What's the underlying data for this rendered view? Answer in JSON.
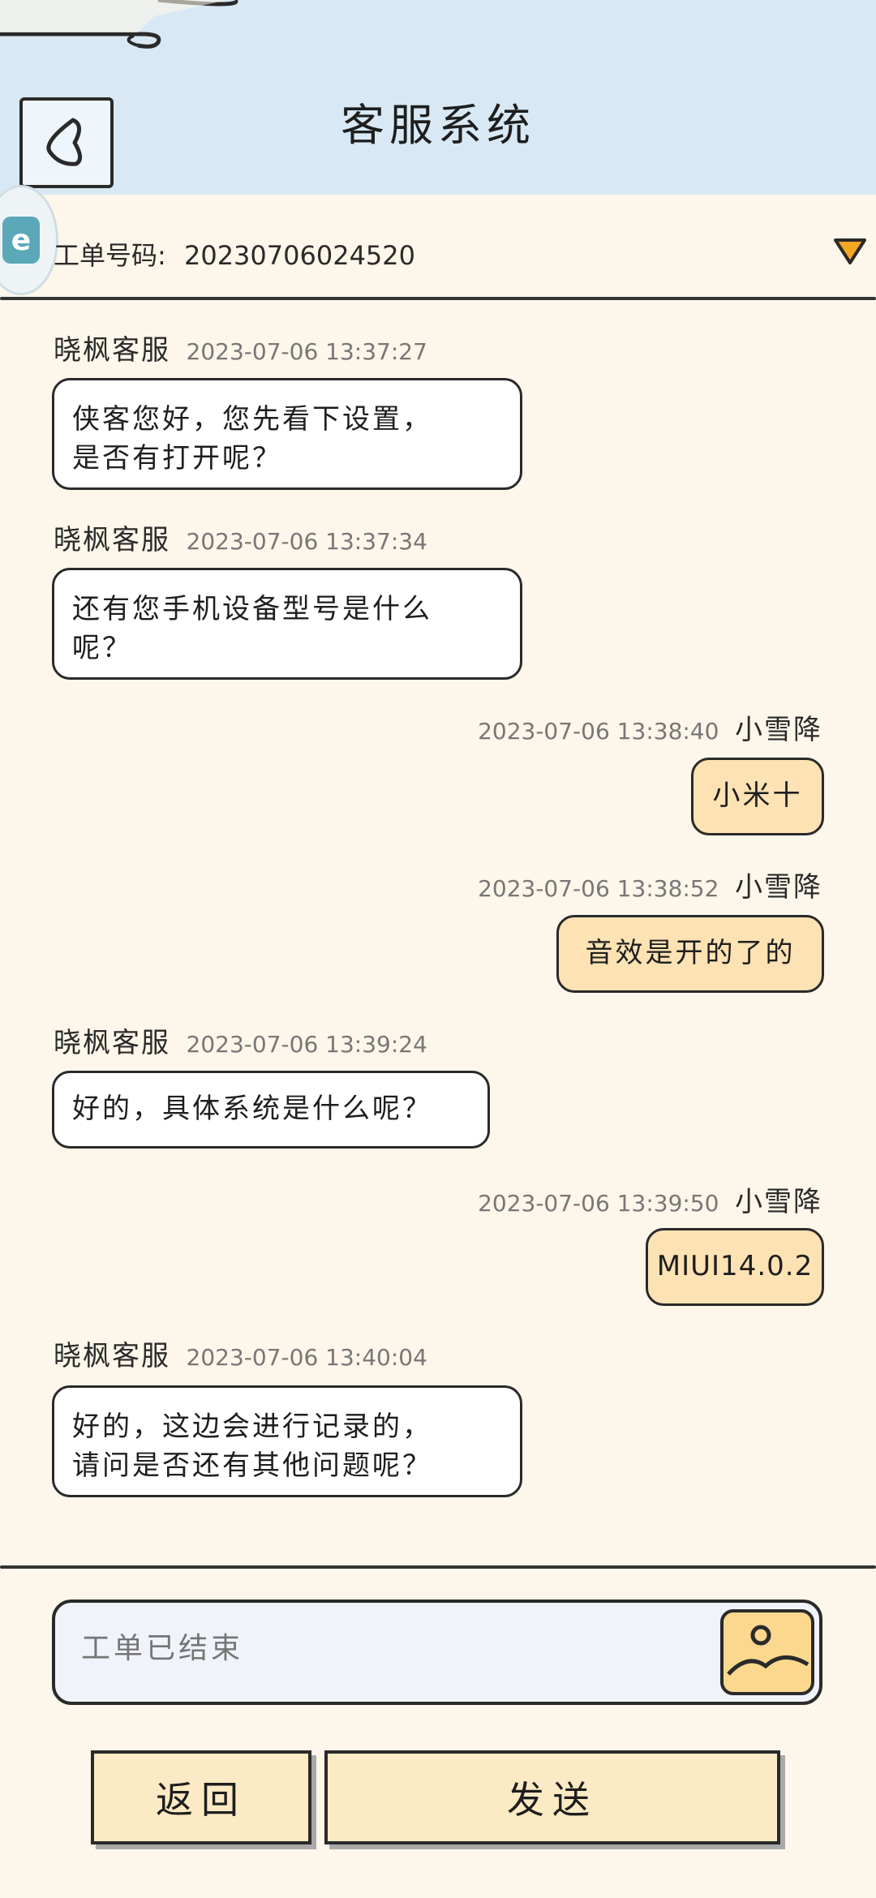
{
  "header": {
    "title": "客服系统"
  },
  "ticket": {
    "label": "工单号码:",
    "number": "20230706024520"
  },
  "messages": [
    {
      "side": "left",
      "name": "晓枫客服",
      "time": "2023-07-06 13:37:27",
      "lines": [
        "侠客您好，您先看下设置，",
        "是否有打开呢？"
      ]
    },
    {
      "side": "left",
      "name": "晓枫客服",
      "time": "2023-07-06 13:37:34",
      "lines": [
        "还有您手机设备型号是什么",
        "呢？"
      ]
    },
    {
      "side": "right",
      "name": "小雪降",
      "time": "2023-07-06 13:38:40",
      "lines": [
        "小米十"
      ]
    },
    {
      "side": "right",
      "name": "小雪降",
      "time": "2023-07-06 13:38:52",
      "lines": [
        "音效是开的了的"
      ]
    },
    {
      "side": "left",
      "name": "晓枫客服",
      "time": "2023-07-06 13:39:24",
      "lines": [
        "好的，具体系统是什么呢？"
      ]
    },
    {
      "side": "right",
      "name": "小雪降",
      "time": "2023-07-06 13:39:50",
      "lines": [
        "MIUI14.0.2"
      ]
    },
    {
      "side": "left",
      "name": "晓枫客服",
      "time": "2023-07-06 13:40:04",
      "lines": [
        "好的，这边会进行记录的，",
        "请问是否还有其他问题呢？"
      ]
    }
  ],
  "composer": {
    "placeholder": "工单已结束"
  },
  "buttons": {
    "back_label": "返回",
    "send_label": "发送"
  },
  "colors": {
    "header_bg": "#d8e9f5",
    "page_bg": "#fdf6ea",
    "user_bubble": "#fde2b4",
    "agent_bubble": "#ffffff",
    "arrow": "#f5a623"
  },
  "icons": {
    "back": "back-chevron-icon",
    "dropdown": "triangle-down-icon",
    "image": "image-picture-icon"
  }
}
